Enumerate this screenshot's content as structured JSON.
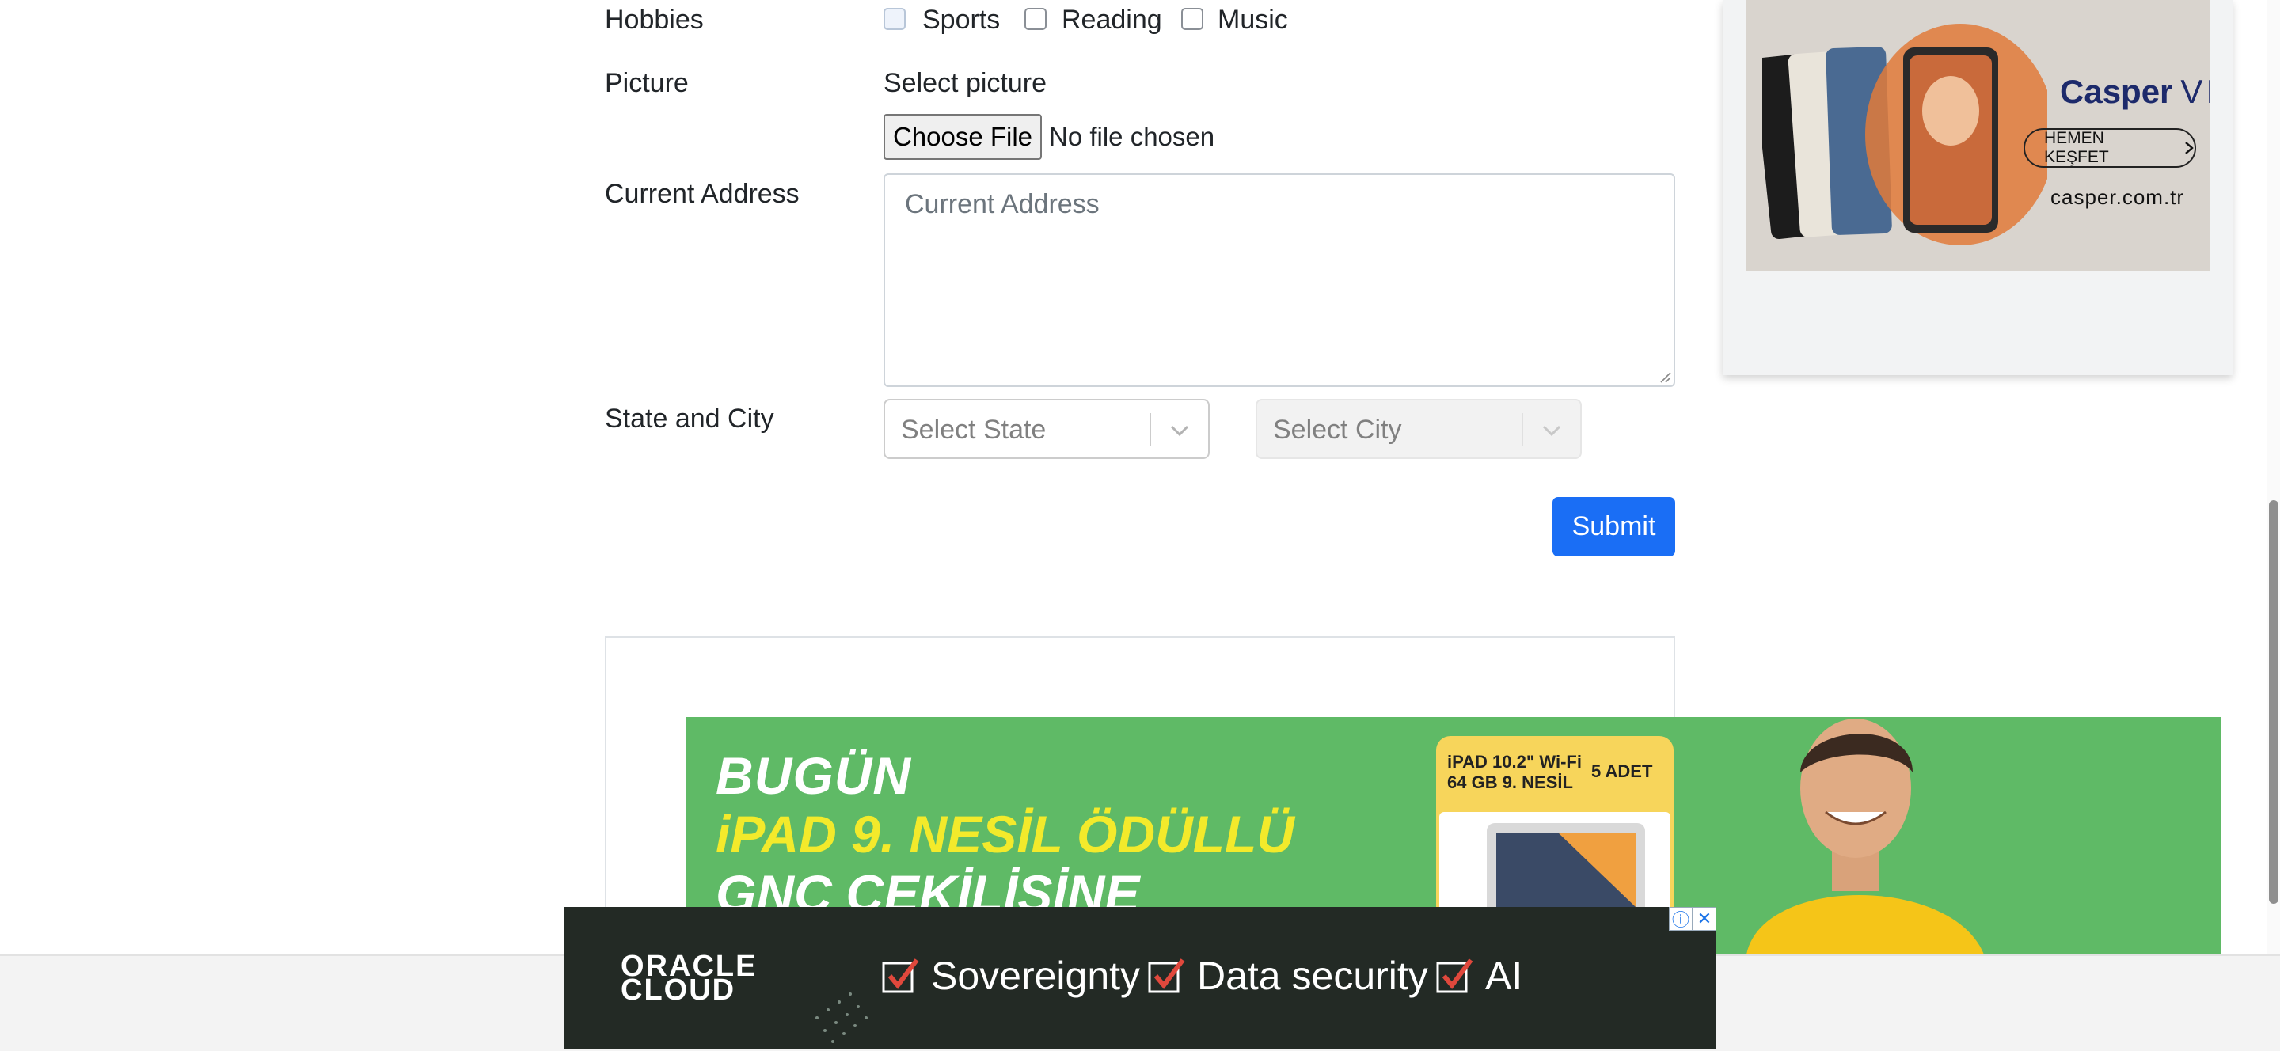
{
  "form": {
    "hobbies_label": "Hobbies",
    "hobbies": [
      {
        "label": "Sports",
        "checked": false
      },
      {
        "label": "Reading",
        "checked": false
      },
      {
        "label": "Music",
        "checked": false
      }
    ],
    "picture_label": "Picture",
    "picture_prompt": "Select picture",
    "file_button": "Choose File",
    "file_status": "No file chosen",
    "address_label": "Current Address",
    "address_placeholder": "Current Address",
    "state_city_label": "State and City",
    "state_placeholder": "Select State",
    "city_placeholder": "Select City",
    "submit_label": "Submit"
  },
  "ads": {
    "casper": {
      "brand": "Casper",
      "model": "VIA",
      "button": "HEMEN KEŞFET",
      "url": "casper.com.tr"
    },
    "green_banner": {
      "line1": "BUGÜN",
      "line2": "iPAD 9. NESİL ÖDÜLLÜ",
      "line3": "GNC ÇEKİLİŞİNE",
      "card_line1": "iPAD 10.2\" Wi-Fi",
      "card_line2": "64 GB 9. NESİL",
      "card_qty": "5 ADET"
    },
    "oracle": {
      "logo_line1": "ORACLE",
      "logo_line2": "CLOUD",
      "items": [
        "Sovereignty",
        "Data security",
        "AI"
      ],
      "info_icon": "ⓘ",
      "close_icon": "✕"
    }
  },
  "colors": {
    "submit": "#1a6ef5",
    "green_ad": "#5fba66",
    "oracle_bg": "#232a25",
    "check_red": "#e0483c"
  }
}
